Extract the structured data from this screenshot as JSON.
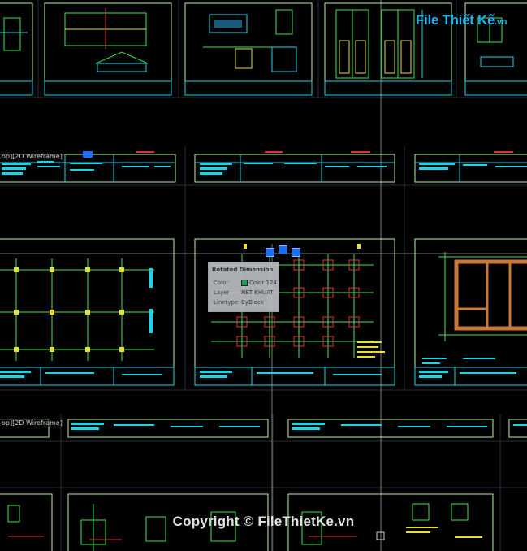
{
  "viewport_labels": [
    "op][2D Wireframe]",
    "op][2D Wireframe]"
  ],
  "tooltip": {
    "title": "Rotated Dimension",
    "rows": [
      {
        "key": "Color",
        "value": "Color 124"
      },
      {
        "key": "Layer",
        "value": "NET KHUAT"
      },
      {
        "key": "Linetype",
        "value": "ByBlock"
      }
    ],
    "swatch_color": "#1c9c5c"
  },
  "watermark": {
    "logo_text": "File Thiết Kế",
    "logo_suffix": ".vn",
    "copyright": "Copyright © FileThietKe.vn"
  },
  "colors": {
    "frame": "#b8f0a0",
    "grid": "#2e3a46",
    "cad_green": "#38e84a",
    "cad_cyan": "#18d6e8",
    "cad_yellow": "#e8e030",
    "cad_red": "#e83030",
    "cad_orange": "#c8783a",
    "grip": "#1a6dff"
  }
}
